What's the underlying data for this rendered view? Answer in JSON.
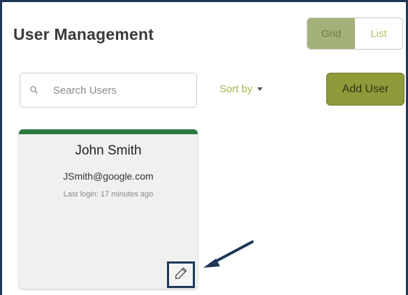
{
  "header": {
    "title": "User Management"
  },
  "view_toggle": {
    "grid_label": "Grid",
    "list_label": "List",
    "active": "Grid"
  },
  "search": {
    "placeholder": "Search Users",
    "value": ""
  },
  "sort": {
    "label": "Sort by"
  },
  "actions": {
    "add_user_label": "Add User"
  },
  "users": [
    {
      "name": "John Smith",
      "email": "JSmith@google.com",
      "last_login": "Last login: 17 minutes ago"
    }
  ],
  "icons": {
    "search": "search-icon",
    "sort_caret": "caret-down-icon",
    "edit": "pencil-icon",
    "annotation": "arrow-icon"
  },
  "colors": {
    "frame_border": "#1f3658",
    "grid_active_bg": "#a3b27a",
    "accent_green": "#a8b64c",
    "add_user_bg": "#8f9a3a",
    "card_top_border": "#2c7a42",
    "card_bg": "#f0f0f0"
  }
}
